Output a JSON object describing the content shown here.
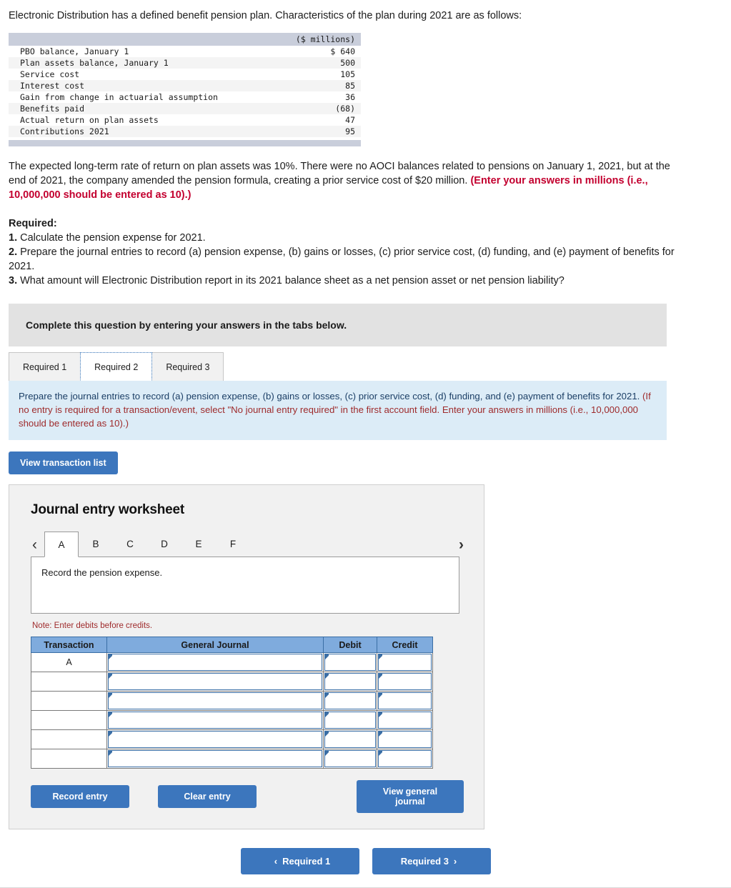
{
  "intro": {
    "text": "Electronic Distribution has a defined benefit pension plan. Characteristics of the plan during 2021 are as follows:"
  },
  "facts_table": {
    "units_header": "($ millions)",
    "rows": [
      {
        "label": "PBO balance, January 1",
        "value": "$ 640"
      },
      {
        "label": "Plan assets balance, January 1",
        "value": "500"
      },
      {
        "label": "Service cost",
        "value": "105"
      },
      {
        "label": "Interest cost",
        "value": "85"
      },
      {
        "label": "Gain from change in actuarial assumption",
        "value": "36"
      },
      {
        "label": "Benefits paid",
        "value": "(68)"
      },
      {
        "label": "Actual return on plan assets",
        "value": "47"
      },
      {
        "label": "Contributions 2021",
        "value": "95"
      }
    ]
  },
  "paragraph": {
    "normal": "The expected long-term rate of return on plan assets was 10%. There were no AOCI balances related to pensions on January 1, 2021, but at the end of 2021, the company amended the pension formula, creating a prior service cost of $20 million. ",
    "emphasis": "(Enter your answers in millions (i.e., 10,000,000 should be entered as 10).)"
  },
  "required": {
    "heading": "Required:",
    "items": [
      {
        "num": "1.",
        "text": " Calculate the pension expense for 2021."
      },
      {
        "num": "2.",
        "text": " Prepare the journal entries to record (a) pension expense, (b) gains or losses, (c) prior service cost, (d) funding, and (e) payment of benefits for 2021."
      },
      {
        "num": "3.",
        "text": " What amount will Electronic Distribution report in its 2021 balance sheet as a net pension asset or net pension liability?"
      }
    ]
  },
  "complete_banner": {
    "text": "Complete this question by entering your answers in the tabs below."
  },
  "required_tabs": {
    "items": [
      {
        "label": "Required 1",
        "active": false
      },
      {
        "label": "Required 2",
        "active": true
      },
      {
        "label": "Required 3",
        "active": false
      }
    ]
  },
  "info_banner": {
    "normal": "Prepare the journal entries to record (a) pension expense, (b) gains or losses, (c) prior service cost, (d) funding, and (e) payment of benefits for 2021. ",
    "red": "(If no entry is required for a transaction/event, select \"No journal entry required\" in the first account field. Enter your answers in millions (i.e., 10,000,000 should be entered as 10).)"
  },
  "view_transaction_list": {
    "label": "View transaction list"
  },
  "worksheet": {
    "title": "Journal entry worksheet",
    "prev_icon": "‹",
    "next_icon": "›",
    "letter_tabs": [
      {
        "label": "A",
        "active": true
      },
      {
        "label": "B",
        "active": false
      },
      {
        "label": "C",
        "active": false
      },
      {
        "label": "D",
        "active": false
      },
      {
        "label": "E",
        "active": false
      },
      {
        "label": "F",
        "active": false
      }
    ],
    "description": "Record the pension expense.",
    "note": "Note: Enter debits before credits.",
    "table": {
      "headers": [
        "Transaction",
        "General Journal",
        "Debit",
        "Credit"
      ],
      "rows": [
        {
          "transaction": "A",
          "general_journal": "",
          "debit": "",
          "credit": ""
        },
        {
          "transaction": "",
          "general_journal": "",
          "debit": "",
          "credit": ""
        },
        {
          "transaction": "",
          "general_journal": "",
          "debit": "",
          "credit": ""
        },
        {
          "transaction": "",
          "general_journal": "",
          "debit": "",
          "credit": ""
        },
        {
          "transaction": "",
          "general_journal": "",
          "debit": "",
          "credit": ""
        },
        {
          "transaction": "",
          "general_journal": "",
          "debit": "",
          "credit": ""
        }
      ]
    },
    "buttons": {
      "record_entry": "Record entry",
      "clear_entry": "Clear entry",
      "view_general_journal": "View general journal"
    }
  },
  "bottom_nav": {
    "prev_icon": "‹",
    "prev_label": "Required 1",
    "next_label": "Required 3",
    "next_icon": "›"
  },
  "colors": {
    "button_blue": "#3c76bd",
    "table_header_blue": "#7fabdd",
    "info_banner_blue": "#dcecf7",
    "banner_grey": "#e2e2e2",
    "red_emphasis": "#c3002f"
  }
}
